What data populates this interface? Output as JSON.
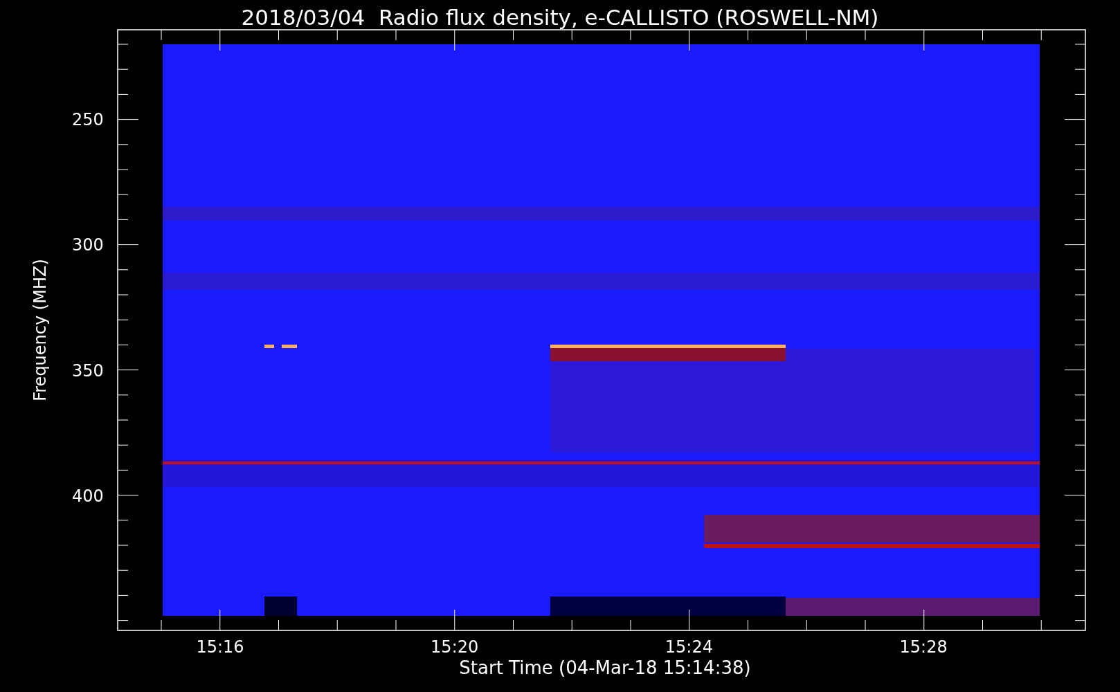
{
  "title": "2018/03/04  Radio flux density, e-CALLISTO (ROSWELL-NM)",
  "y_axis": {
    "label": "Frequency (MHZ)",
    "ticks": [
      "250",
      "300",
      "350",
      "400"
    ]
  },
  "x_axis": {
    "label": "Start Time (04-Mar-18 15:14:38)",
    "ticks": [
      "15:16",
      "15:20",
      "15:24",
      "15:28"
    ]
  }
}
